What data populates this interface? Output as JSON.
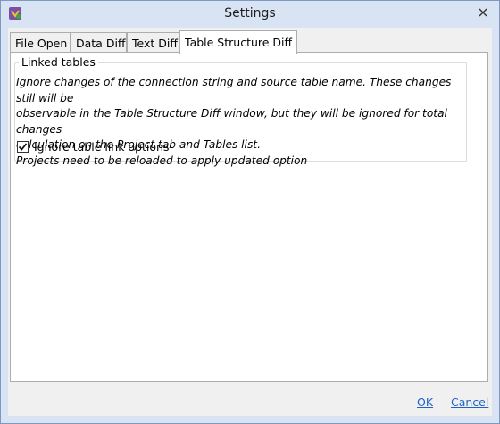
{
  "window": {
    "title": "Settings"
  },
  "tabs": [
    {
      "label": "File Open"
    },
    {
      "label": "Data Diff"
    },
    {
      "label": "Text Diff"
    },
    {
      "label": "Table Structure Diff"
    }
  ],
  "group": {
    "title": "Linked tables",
    "description_lines": [
      "Ignore changes of the connection string and source table name. These changes still will be",
      "observable in the Table Structure Diff window, but they will be ignored for total changes",
      "calculation on the Project tab and Tables list.",
      "Projects need to be reloaded to apply updated option"
    ],
    "checkbox": {
      "label": "Ignore table link options",
      "checked": true
    }
  },
  "footer": {
    "ok_label": "OK",
    "cancel_label": "Cancel"
  },
  "icons": {
    "app": "app-icon",
    "close": "close-icon",
    "check": "checkmark-icon"
  },
  "colors": {
    "link": "#1e64c8",
    "titlebar": "#d8e4f4"
  }
}
